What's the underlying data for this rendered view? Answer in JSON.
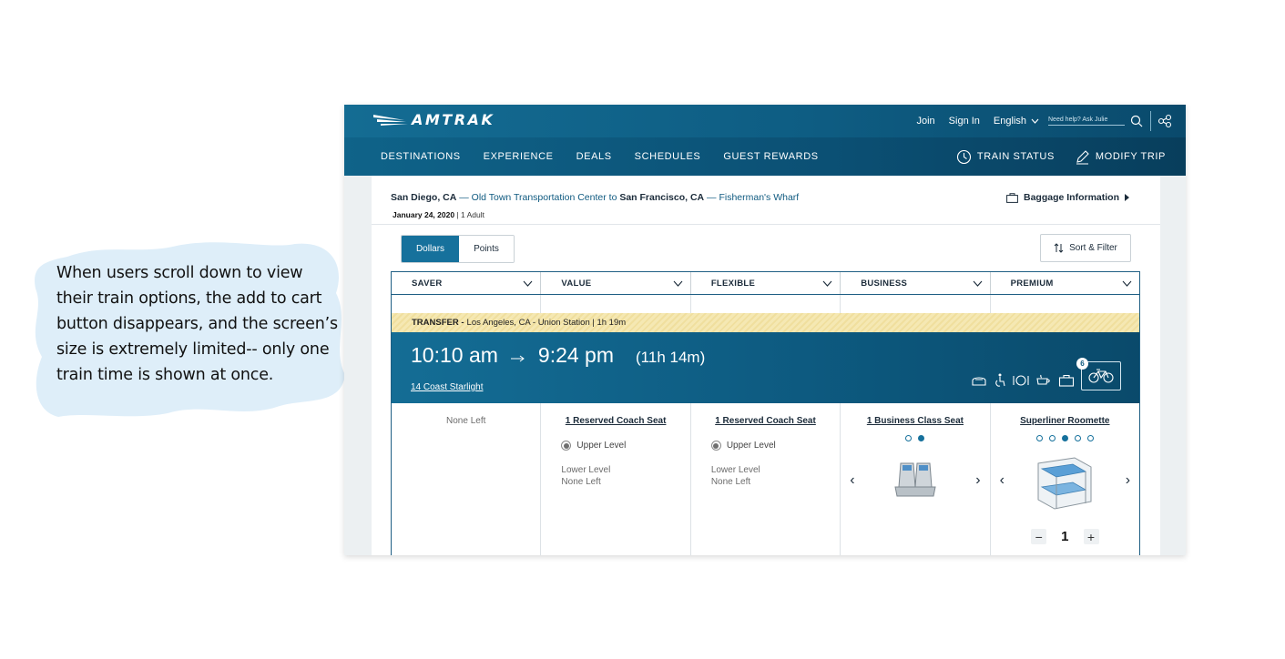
{
  "annotation": {
    "text": "When users scroll down to view their train options, the add to cart button disappears, and the screen’s size is extremely limited-- only one train time is shown at once."
  },
  "header": {
    "logo_text": "AMTRAK",
    "links": {
      "join": "Join",
      "sign_in": "Sign In",
      "language": "English"
    },
    "search_placeholder": "Need help? Ask Julie"
  },
  "nav": {
    "items": [
      "DESTINATIONS",
      "EXPERIENCE",
      "DEALS",
      "SCHEDULES",
      "GUEST REWARDS"
    ],
    "train_status": "TRAIN STATUS",
    "modify_trip": "MODIFY TRIP"
  },
  "trip": {
    "origin": "San Diego, CA",
    "origin_station": " — Old Town Transportation Center to ",
    "destination": "San Francisco, CA",
    "destination_station": " — Fisherman's Wharf",
    "date": "January 24, 2020",
    "separator": " | ",
    "passengers": "1 Adult",
    "baggage_label": "Baggage Information"
  },
  "controls": {
    "dollars": "Dollars",
    "points": "Points",
    "sort_filter": "Sort & Filter"
  },
  "fares": [
    "SAVER",
    "VALUE",
    "FLEXIBLE",
    "BUSINESS",
    "PREMIUM"
  ],
  "transfer": {
    "label": "TRANSFER -",
    "detail": "Los Angeles, CA - Union Station | 1h 19m"
  },
  "train": {
    "depart": "10:10 am",
    "arrive": "9:24 pm",
    "duration": "(11h 14m)",
    "name": "14 Coast Starlight",
    "bike_count": "6"
  },
  "seats": {
    "saver": {
      "status": "None Left"
    },
    "value": {
      "title": "1 Reserved Coach Seat",
      "upper": "Upper Level",
      "lower": "Lower Level",
      "lower_status": "None Left"
    },
    "flexible": {
      "title": "1 Reserved Coach Seat",
      "upper": "Upper Level",
      "lower": "Lower Level",
      "lower_status": "None Left"
    },
    "business": {
      "title": "1 Business Class Seat"
    },
    "premium": {
      "title": "Superliner Roomette",
      "qty": "1"
    }
  },
  "colors": {
    "brand_blue": "#0e5d83",
    "accent_blue": "#16719c",
    "transfer_bg": "#f5e8b3"
  }
}
